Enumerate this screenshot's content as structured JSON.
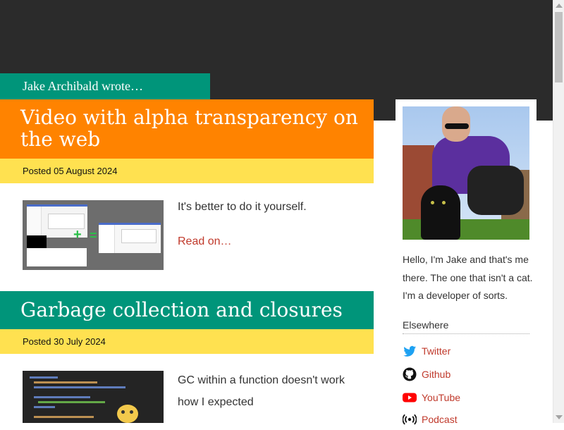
{
  "author": {
    "tagline": "Jake Archibald wrote…"
  },
  "posts": [
    {
      "title": "Video with alpha transparency on the web",
      "date": "Posted 05 August 2024",
      "excerpt": "It's better to do it yourself.",
      "read_more": "Read on…"
    },
    {
      "title": "Garbage collection and closures",
      "date": "Posted 30 July 2024",
      "excerpt": "GC within a function doesn't work how I expected"
    }
  ],
  "sidebar": {
    "bio": "Hello, I'm Jake and that's me there. The one that isn't a cat. I'm a developer of sorts.",
    "elsewhere_heading": "Elsewhere",
    "links": [
      {
        "label": "Twitter",
        "icon": "twitter-icon",
        "color": "#1da1f2"
      },
      {
        "label": "Github",
        "icon": "github-icon",
        "color": "#111111"
      },
      {
        "label": "YouTube",
        "icon": "youtube-icon",
        "color": "#ff0000"
      },
      {
        "label": "Podcast",
        "icon": "podcast-icon",
        "color": "#111111"
      }
    ]
  },
  "colors": {
    "header_bg": "#2b2b2b",
    "teal": "#00957a",
    "orange": "#ff8300",
    "yellow": "#ffe150",
    "link": "#c0392b"
  }
}
